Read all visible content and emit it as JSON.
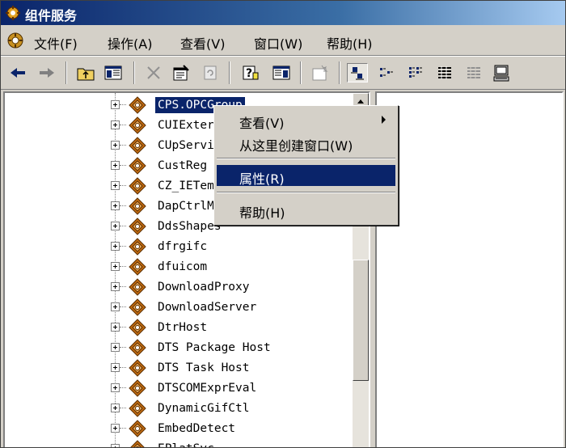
{
  "window": {
    "title": "组件服务"
  },
  "menu": {
    "items": [
      "文件(F)",
      "操作(A)",
      "查看(V)",
      "窗口(W)",
      "帮助(H)"
    ]
  },
  "toolbar": {
    "icons": [
      "back-arrow-icon",
      "forward-arrow-icon",
      "up-folder-icon",
      "show-hide-tree-icon",
      "delete-icon",
      "properties-icon",
      "refresh-icon",
      "help-icon",
      "show-hide-action-pane-icon",
      "new-window-icon",
      "large-icons-view-icon",
      "small-icons-view-icon",
      "list-view-icon",
      "detail-view-icon",
      "status-view-icon",
      "computer-icon"
    ],
    "pressed": "large-icons-view-icon"
  },
  "tree": {
    "items": [
      "CPS.OPCGroup",
      "CUIExternal",
      "CUpServices",
      "CustReg",
      "CZ_IETemp",
      "DapCtrlMgr",
      "DdsShapes",
      "dfrgifc",
      "dfuicom",
      "DownloadProxy",
      "DownloadServer",
      "DtrHost",
      "DTS Package Host",
      "DTS Task Host",
      "DTSCOMExprEval",
      "DynamicGifCtl",
      "EmbedDetect",
      "EPlatSvc"
    ],
    "selected_index": 0
  },
  "context_menu": {
    "view": "查看(V)",
    "new_window": "从这里创建窗口(W)",
    "properties": "属性(R)",
    "help": "帮助(H)"
  },
  "colors": {
    "selection": "#0a246a",
    "face": "#d4d0c8",
    "component_icon": "#c06a10"
  }
}
